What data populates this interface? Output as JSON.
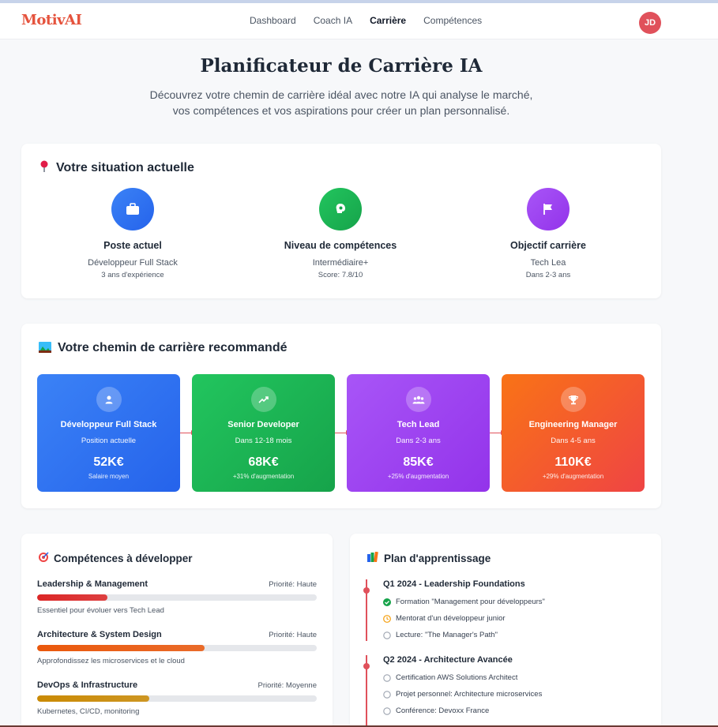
{
  "app": {
    "logo": "MotivAI",
    "avatar_initials": "JD"
  },
  "nav": [
    {
      "label": "Dashboard",
      "active": false
    },
    {
      "label": "Coach IA",
      "active": false
    },
    {
      "label": "Carrière",
      "active": true
    },
    {
      "label": "Compétences",
      "active": false
    }
  ],
  "hero": {
    "title": "Planificateur de Carrière IA",
    "subtitle_line1": "Découvrez votre chemin de carrière idéal avec notre IA qui analyse le marché,",
    "subtitle_line2": "vos compétences et vos aspirations pour créer un plan personnalisé."
  },
  "situation": {
    "title": "Votre situation actuelle",
    "items": [
      {
        "label": "Poste actuel",
        "value": "Développeur Full Stack",
        "detail": "3 ans d'expérience",
        "color": "#3b82f6",
        "icon": "briefcase-icon"
      },
      {
        "label": "Niveau de compétences",
        "value": "Intermédiaire+",
        "detail": "Score: 7.8/10",
        "color": "#16a34a",
        "icon": "brain-icon"
      },
      {
        "label": "Objectif carrière",
        "value": "Tech Lea",
        "detail": "Dans 2-3 ans",
        "color": "#9333ea",
        "icon": "flag-icon"
      }
    ]
  },
  "path": {
    "title": "Votre chemin de carrière recommandé",
    "steps": [
      {
        "title": "Développeur Full Stack",
        "time": "Position actuelle",
        "salary": "52K€",
        "note": "Salaire moyen",
        "icon": "user-icon",
        "from": "#3b82f6",
        "to": "#2563eb"
      },
      {
        "title": "Senior Developer",
        "time": "Dans 12-18 mois",
        "salary": "68K€",
        "note": "+31% d'augmentation",
        "icon": "trending-up-icon",
        "from": "#22c55e",
        "to": "#16a34a"
      },
      {
        "title": "Tech Lead",
        "time": "Dans 2-3 ans",
        "salary": "85K€",
        "note": "+25% d'augmentation",
        "icon": "users-icon",
        "from": "#a855f7",
        "to": "#9333ea"
      },
      {
        "title": "Engineering Manager",
        "time": "Dans 4-5 ans",
        "salary": "110K€",
        "note": "+29% d'augmentation",
        "icon": "trophy-icon",
        "from": "#f97316",
        "to": "#ef4444"
      }
    ]
  },
  "skills": {
    "title": "Compétences à développer",
    "items": [
      {
        "name": "Leadership & Management",
        "priority": "Priorité: Haute",
        "progress": 0.25,
        "desc": "Essentiel pour évoluer vers Tech Lead",
        "color": "#dc2626"
      },
      {
        "name": "Architecture & System Design",
        "priority": "Priorité: Haute",
        "progress": 0.6,
        "desc": "Approfondissez les microservices et le cloud",
        "color": "#ea580c"
      },
      {
        "name": "DevOps & Infrastructure",
        "priority": "Priorité: Moyenne",
        "progress": 0.4,
        "desc": "Kubernetes, CI/CD, monitoring",
        "color": "#ca8a04"
      }
    ]
  },
  "learning": {
    "title": "Plan d'apprentissage",
    "quarters": [
      {
        "title": "Q1 2024 - Leadership Foundations",
        "items": [
          {
            "label": "Formation \"Management pour développeurs\"",
            "status": "done"
          },
          {
            "label": "Mentorat d'un développeur junior",
            "status": "in-progress"
          },
          {
            "label": "Lecture: \"The Manager's Path\"",
            "status": "todo"
          }
        ]
      },
      {
        "title": "Q2 2024 - Architecture Avancée",
        "items": [
          {
            "label": "Certification AWS Solutions Architect",
            "status": "todo"
          },
          {
            "label": "Projet personnel: Architecture microservices",
            "status": "todo"
          },
          {
            "label": "Conférence: Devoxx France",
            "status": "todo"
          }
        ]
      }
    ]
  }
}
